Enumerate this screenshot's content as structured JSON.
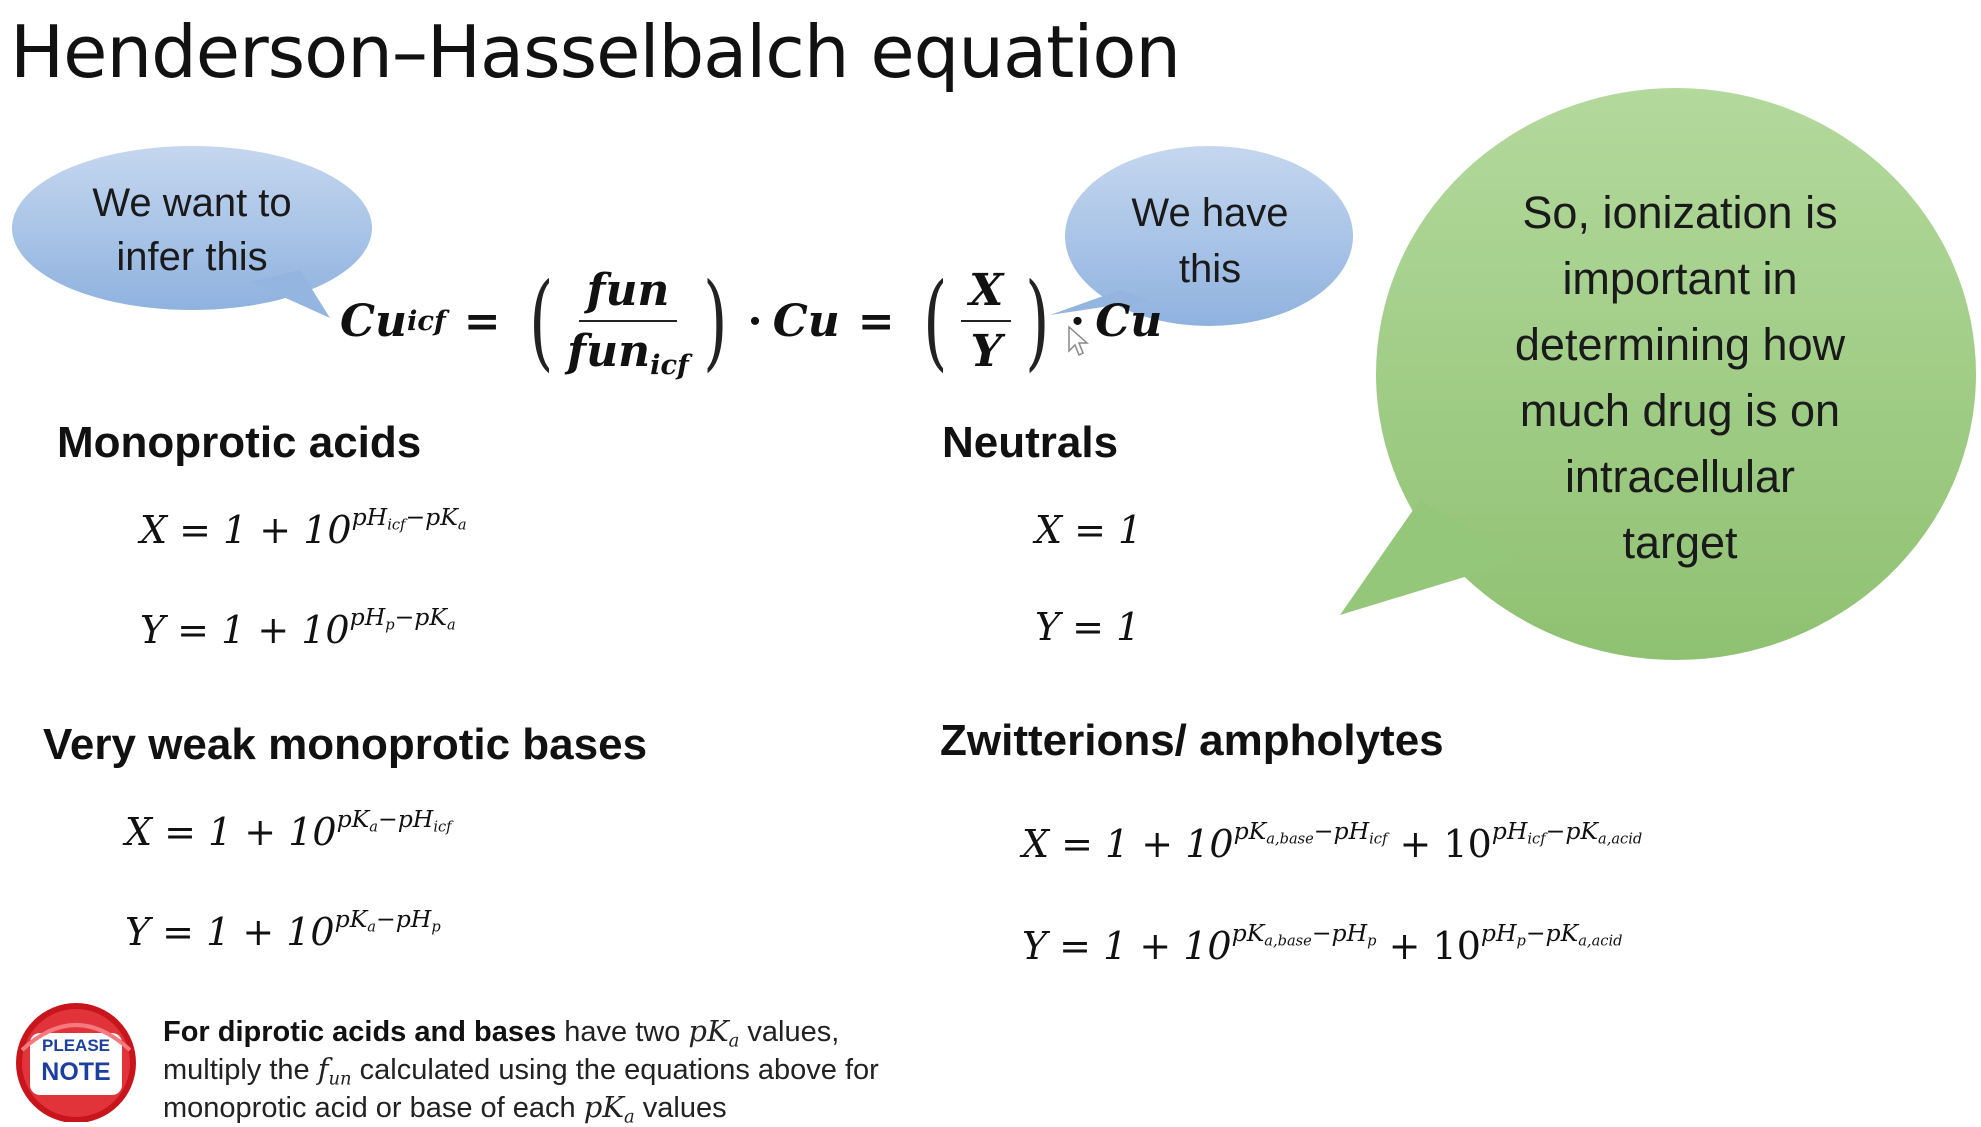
{
  "title": "Henderson–Hasselbalch equation",
  "callouts": {
    "infer": {
      "line1": "We want to",
      "line2": "infer this",
      "color": "#a9c4e6"
    },
    "have": {
      "line1": "We have",
      "line2": "this",
      "color": "#a9c4e6"
    },
    "ionization": {
      "lines": [
        "So, ionization is",
        "important in",
        "determining how",
        "much drug is on",
        "intracellular",
        "target"
      ],
      "color": "#9fcd85"
    }
  },
  "main_equation": {
    "lhs": "Cu",
    "lhs_sub": "icf",
    "eq": "=",
    "frac_num": "fun",
    "frac_den": "fun",
    "frac_den_sub": "icf",
    "mid": "Cu",
    "frac2_num": "X",
    "frac2_den": "Y",
    "rhs": "Cu",
    "dot": "·"
  },
  "sections": {
    "mono_acids": {
      "heading": "Monoprotic acids",
      "x": {
        "lhs": "X = 1 + 10",
        "exp": "pH",
        "exp_sub": "icf",
        "exp_rest": "−pK",
        "exp_sub2": "a"
      },
      "y": {
        "lhs": "Y = 1 + 10",
        "exp": "pH",
        "exp_sub": "p",
        "exp_rest": "−pK",
        "exp_sub2": "a"
      }
    },
    "neutrals": {
      "heading": "Neutrals",
      "x": "X = 1",
      "y": "Y = 1"
    },
    "weak_bases": {
      "heading": "Very weak monoprotic bases",
      "x": {
        "lhs": "X = 1 + 10",
        "exp": "pK",
        "exp_sub": "a",
        "exp_rest": "−pH",
        "exp_sub2": "icf"
      },
      "y": {
        "lhs": "Y = 1 + 10",
        "exp": "pK",
        "exp_sub": "a",
        "exp_rest": "−pH",
        "exp_sub2": "p"
      }
    },
    "zwitterions": {
      "heading": "Zwitterions/ ampholytes",
      "x": {
        "lhs": "X = 1 + 10",
        "t1a": "pK",
        "t1s": "a,base",
        "t1b": "−pH",
        "t1s2": "icf",
        "plus": "+ 10",
        "t2a": "pH",
        "t2s": "icf",
        "t2b": "−pK",
        "t2s2": "a,acid"
      },
      "y": {
        "lhs": "Y = 1 + 10",
        "t1a": "pK",
        "t1s": "a,base",
        "t1b": "−pH",
        "t1s2": "p",
        "plus": "+ 10",
        "t2a": "pH",
        "t2s": "p",
        "t2b": "−pK",
        "t2s2": "a,acid"
      }
    }
  },
  "note": {
    "badge_line1": "PLEASE",
    "badge_line2": "NOTE",
    "bold": "For diprotic acids and bases",
    "l1_rest": " have two ",
    "pk": "pK",
    "pk_sub": "a",
    "l1_end": " values,",
    "l2_a": "multiply the ",
    "f": "f",
    "f_sub": "un",
    "l2_b": " calculated using the equations above for",
    "l3_a": "monoprotic acid or base of each ",
    "l3_end": " values"
  }
}
